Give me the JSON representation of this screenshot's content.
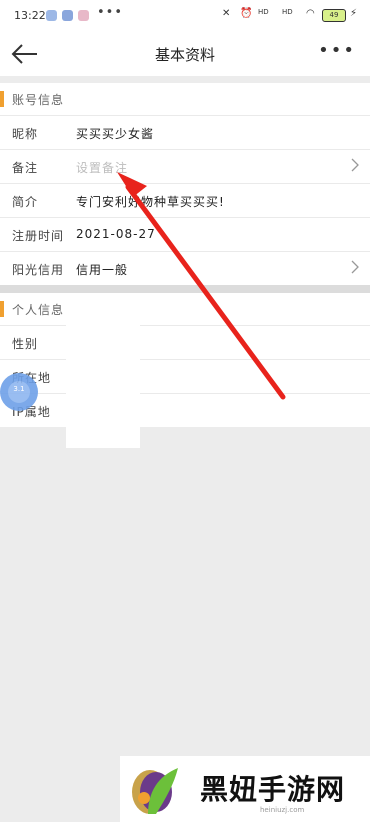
{
  "statusbar": {
    "time": "13:22",
    "more": "•••",
    "signal_a": "HD",
    "signal_b": "HD",
    "battery": "49"
  },
  "navbar": {
    "title": "基本资料",
    "more": "•••"
  },
  "account_section": {
    "title": "账号信息",
    "rows": [
      {
        "label": "昵称",
        "value": "买买买少女酱"
      },
      {
        "label": "备注",
        "placeholder": "设置备注"
      },
      {
        "label": "简介",
        "value": "专门安利好物种草买买买!"
      },
      {
        "label": "注册时间",
        "value": "2021-08-27"
      },
      {
        "label": "阳光信用",
        "value": "信用一般"
      }
    ]
  },
  "personal_section": {
    "title": "个人信息",
    "rows": [
      {
        "label": "性别"
      },
      {
        "label": "所在地"
      },
      {
        "label": "IP属地"
      }
    ]
  },
  "float_button": {
    "label": "3.1"
  },
  "watermark": {
    "text": "黑妞手游网",
    "url": "heiniuzj.com"
  },
  "colors": {
    "accent": "#f0a030",
    "arrow": "#e8231c",
    "float": "#6ea0e8"
  }
}
